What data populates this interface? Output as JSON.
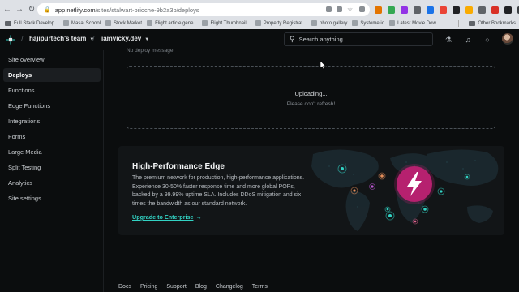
{
  "browser": {
    "url_host": "app.netlify.com",
    "url_path": "/sites/stalwart-brioche-9b2a3b/deploys",
    "bookmarks": [
      "Full Stack Develop...",
      "Masai School",
      "Stock Market",
      "Flight article gene...",
      "Flight Thumbnail...",
      "Property Registrat...",
      "photo gallery",
      "Systeme.io",
      "Latest Movie Dow..."
    ],
    "other_bookmarks": "Other Bookmarks",
    "ext_colors": [
      "#e37400",
      "#34a853",
      "#9334e6",
      "#5f6368",
      "#1a73e8",
      "#ea4335",
      "#202124",
      "#f9ab00",
      "#5f6368",
      "#d93025",
      "#202124",
      "#3c4043"
    ]
  },
  "header": {
    "team": "hajipurtech's team",
    "site": "iamvicky.dev",
    "search_placeholder": "Search anything..."
  },
  "sidebar": {
    "items": [
      {
        "label": "Site overview",
        "active": false
      },
      {
        "label": "Deploys",
        "active": true
      },
      {
        "label": "Functions",
        "active": false
      },
      {
        "label": "Edge Functions",
        "active": false
      },
      {
        "label": "Integrations",
        "active": false
      },
      {
        "label": "Forms",
        "active": false
      },
      {
        "label": "Large Media",
        "active": false
      },
      {
        "label": "Split Testing",
        "active": false
      },
      {
        "label": "Analytics",
        "active": false
      },
      {
        "label": "Site settings",
        "active": false
      }
    ]
  },
  "main": {
    "cut_text": "No deploy message",
    "upload_status": "Uploading...",
    "upload_hint": "Please don't refresh!",
    "edge": {
      "title": "High-Performance Edge",
      "description": "The premium network for production, high-performance applications. Experience 30-50% faster response time and more global POPs, backed by a 99.99% uptime SLA. Includes DDoS mitigation and six times the bandwidth as our standard network.",
      "link": "Upgrade to Enterprise",
      "accent": "#32d3c4",
      "badge_color": "#b6216f"
    }
  },
  "footer": {
    "links": [
      "Docs",
      "Pricing",
      "Support",
      "Blog",
      "Changelog",
      "Terms"
    ]
  }
}
